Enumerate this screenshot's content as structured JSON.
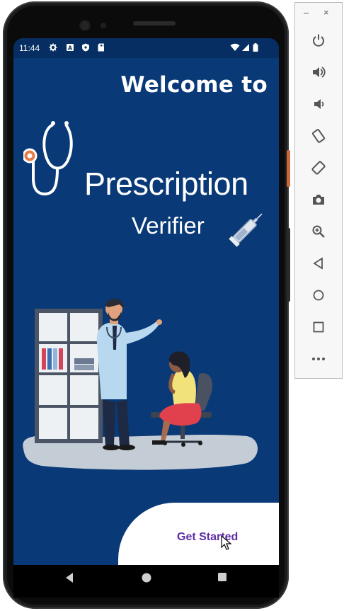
{
  "status_bar": {
    "time": "11:44"
  },
  "screen": {
    "welcome_text": "Welcome to",
    "title": "Prescription",
    "subtitle": "Verifier",
    "cta_label": "Get Started"
  },
  "icons": {
    "status_left": [
      "settings-icon",
      "a-icon",
      "shield-icon",
      "sd-card-icon"
    ],
    "status_right": [
      "wifi-icon",
      "signal-icon",
      "battery-icon"
    ],
    "nav": [
      "back-icon",
      "home-icon",
      "recents-icon"
    ],
    "emulator_panel": [
      "power-icon",
      "volume-up-icon",
      "volume-down-icon",
      "rotate-left-icon",
      "rotate-right-icon",
      "camera-icon",
      "zoom-icon",
      "back-icon",
      "home-icon",
      "overview-icon",
      "more-icon"
    ]
  },
  "panel_window_controls": {
    "minimize": "–",
    "close": "×"
  },
  "colors": {
    "screen_bg": "#093976",
    "status_bg": "#062e62",
    "cta_text": "#5e2ca5"
  }
}
